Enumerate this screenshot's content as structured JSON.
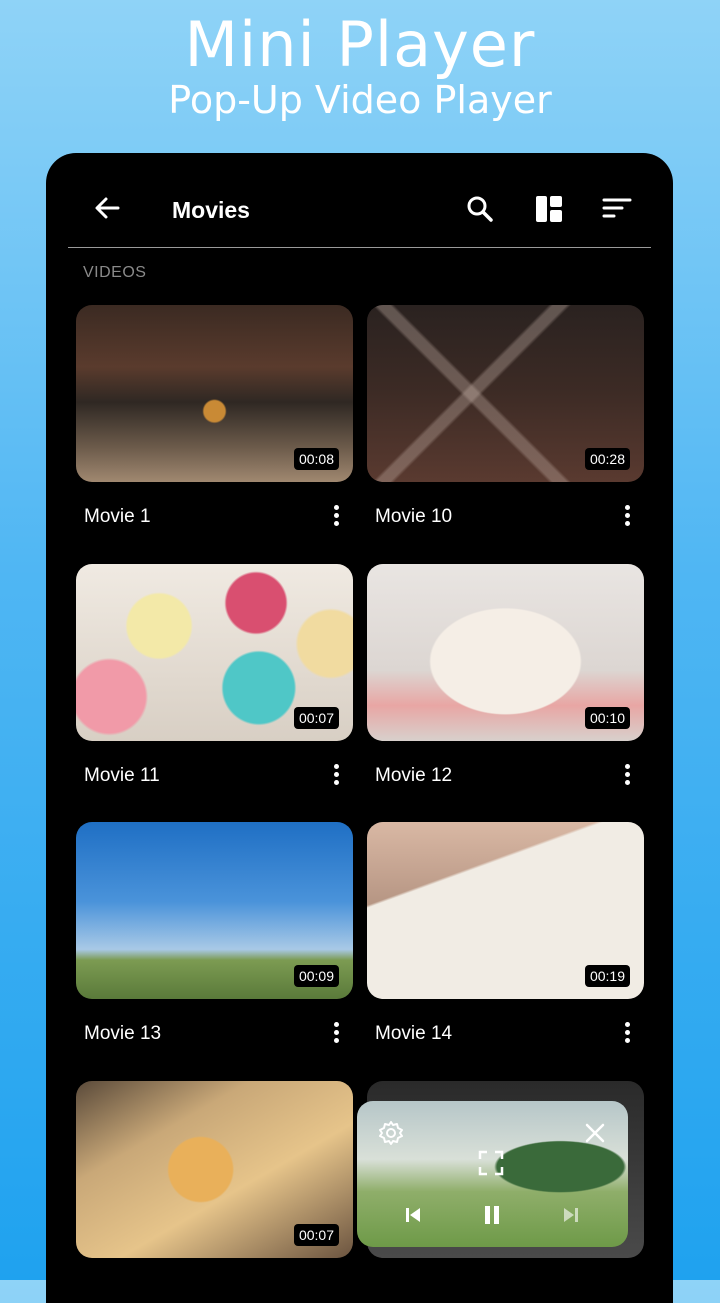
{
  "promo": {
    "title": "Mini Player",
    "subtitle": "Pop-Up Video Player"
  },
  "appbar": {
    "title": "Movies",
    "icons": [
      "back-arrow-icon",
      "search-icon",
      "grid-layout-icon",
      "sort-icon"
    ]
  },
  "section_label": "VIDEOS",
  "videos": [
    {
      "name": "Movie 1",
      "duration": "00:08"
    },
    {
      "name": "Movie 10",
      "duration": "00:28"
    },
    {
      "name": "Movie 11",
      "duration": "00:07"
    },
    {
      "name": "Movie 12",
      "duration": "00:10"
    },
    {
      "name": "Movie 13",
      "duration": "00:09"
    },
    {
      "name": "Movie 14",
      "duration": "00:19"
    },
    {
      "name": "",
      "duration": "00:07"
    },
    {
      "name": "",
      "duration": ""
    }
  ],
  "mini_player": {
    "icons": [
      "settings-icon",
      "close-icon",
      "fullscreen-icon",
      "previous-icon",
      "pause-icon",
      "next-icon"
    ]
  }
}
